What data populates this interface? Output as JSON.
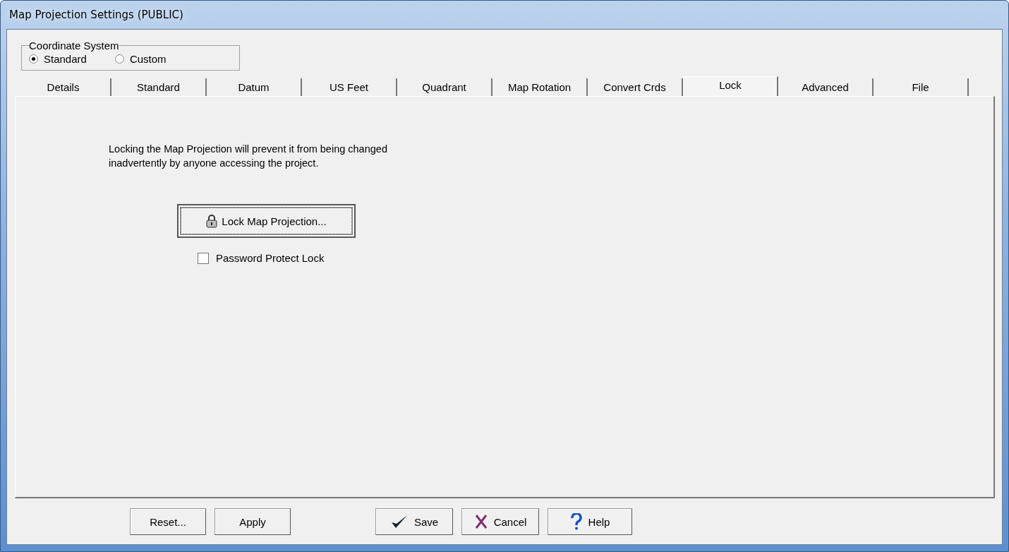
{
  "window": {
    "title": "Map Projection Settings (PUBLIC)"
  },
  "coordinate_system": {
    "label": "Coordinate System",
    "options": [
      {
        "label": "Standard",
        "selected": true
      },
      {
        "label": "Custom",
        "selected": false
      }
    ]
  },
  "tabs": [
    {
      "label": "Details",
      "selected": false
    },
    {
      "label": "Standard",
      "selected": false
    },
    {
      "label": "Datum",
      "selected": false
    },
    {
      "label": "US Feet",
      "selected": false
    },
    {
      "label": "Quadrant",
      "selected": false
    },
    {
      "label": "Map Rotation",
      "selected": false
    },
    {
      "label": "Convert Crds",
      "selected": false
    },
    {
      "label": "Lock",
      "selected": true
    },
    {
      "label": "Advanced",
      "selected": false
    },
    {
      "label": "File",
      "selected": false
    }
  ],
  "lock_panel": {
    "description": "Locking the Map Projection will prevent it from being changed inadvertently by anyone accessing the project.",
    "lock_button": "Lock Map Projection...",
    "password_protect": {
      "label": "Password Protect Lock",
      "checked": false
    }
  },
  "buttons": [
    {
      "label": "Reset...",
      "kind": "plain"
    },
    {
      "label": "Apply",
      "kind": "plain"
    },
    {
      "label": "Save",
      "kind": "save"
    },
    {
      "label": "Cancel",
      "kind": "cancel"
    },
    {
      "label": "Help",
      "kind": "help"
    }
  ]
}
